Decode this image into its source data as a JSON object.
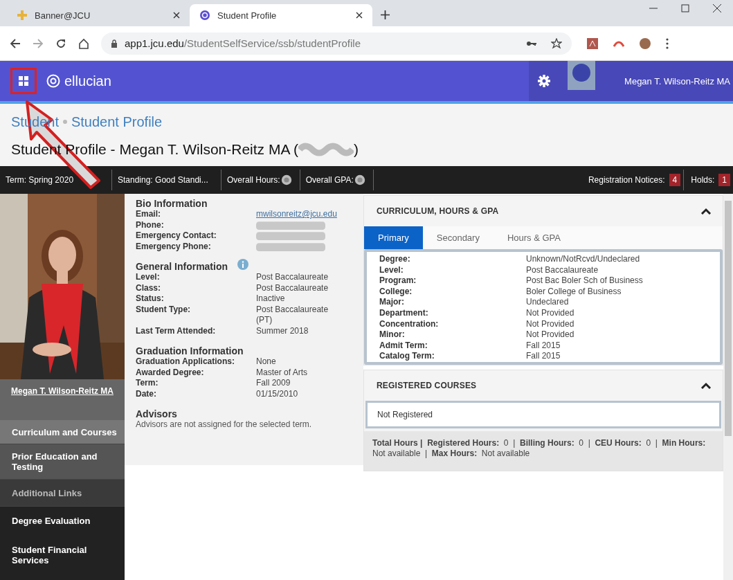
{
  "browser": {
    "tabs": [
      {
        "title": "Banner@JCU",
        "selected": false
      },
      {
        "title": "Student Profile",
        "selected": true
      }
    ],
    "url_host": "app1.jcu.edu",
    "url_path": "/StudentSelfService/ssb/studentProfile"
  },
  "header": {
    "brand": "ellucian",
    "user_name": "Megan T. Wilson-Reitz MA"
  },
  "breadcrumb": [
    "Student",
    "Student Profile"
  ],
  "page_title": {
    "text": "Student Profile - Megan T. Wilson-Reitz MA (",
    "close": ")"
  },
  "summary_bar": {
    "items": [
      {
        "label": "Term:",
        "value": "Spring 2020",
        "kind": "text"
      },
      {
        "label": "Standing:",
        "value": "Good Standi...",
        "kind": "text"
      },
      {
        "label": "Overall Hours:",
        "kind": "redacted"
      },
      {
        "label": "Overall GPA:",
        "kind": "redacted"
      }
    ],
    "badges": [
      {
        "label": "Registration Notices:",
        "count": "4"
      },
      {
        "label": "Holds:",
        "count": "1"
      }
    ]
  },
  "sidebar": {
    "profile_name": "Megan T. Wilson-Reitz MA",
    "items": [
      {
        "label": "Curriculum and Courses",
        "kind": "section",
        "selected": true
      },
      {
        "label": "Prior Education and Testing",
        "kind": "section",
        "selected": false
      },
      {
        "label": "Additional Links",
        "kind": "heading",
        "selected": false
      },
      {
        "label": "Degree Evaluation",
        "kind": "link",
        "selected": false
      },
      {
        "label": "Student Financial Services",
        "kind": "link",
        "selected": false
      }
    ]
  },
  "profile_sections": [
    {
      "title": "Bio Information",
      "info": false,
      "rows": [
        {
          "label": "Email:",
          "value": "mwilsonreitz@jcu.edu",
          "kind": "link"
        },
        {
          "label": "Phone:",
          "kind": "redacted"
        },
        {
          "label": "Emergency Contact:",
          "kind": "redacted"
        },
        {
          "label": "Emergency Phone:",
          "kind": "redacted"
        }
      ]
    },
    {
      "title": "General Information",
      "info": true,
      "rows": [
        {
          "label": "Level:",
          "value": "Post Baccalaureate",
          "kind": "text"
        },
        {
          "label": "Class:",
          "value": "Post Baccalaureate",
          "kind": "text"
        },
        {
          "label": "Status:",
          "value": "Inactive",
          "kind": "text"
        },
        {
          "label": "Student Type:",
          "value": "Post Baccalaureate (PT)",
          "kind": "text"
        },
        {
          "label": "Last Term Attended:",
          "value": "Summer 2018",
          "kind": "text"
        }
      ]
    },
    {
      "title": "Graduation Information",
      "info": false,
      "rows": [
        {
          "label": "Graduation Applications:",
          "value": "None",
          "kind": "text"
        },
        {
          "label": "Awarded Degree:",
          "value": "Master of Arts",
          "kind": "text"
        },
        {
          "label": "Term:",
          "value": "Fall 2009",
          "kind": "text"
        },
        {
          "label": "Date:",
          "value": "01/15/2010",
          "kind": "text"
        }
      ]
    },
    {
      "title": "Advisors",
      "info": false,
      "note": "Advisors are not assigned for the selected term."
    }
  ],
  "curriculum_panel": {
    "title": "CURRICULUM, HOURS & GPA",
    "expanded": true,
    "tabs": [
      {
        "label": "Primary",
        "selected": true
      },
      {
        "label": "Secondary",
        "selected": false
      },
      {
        "label": "Hours & GPA",
        "selected": false
      }
    ],
    "rows": [
      {
        "label": "Degree:",
        "value": "Unknown/NotRcvd/Undeclared"
      },
      {
        "label": "Level:",
        "value": "Post Baccalaureate"
      },
      {
        "label": "Program:",
        "value": "Post Bac Boler Sch of Business"
      },
      {
        "label": "College:",
        "value": "Boler College of Business"
      },
      {
        "label": "Major:",
        "value": "Undeclared"
      },
      {
        "label": "Department:",
        "value": "Not Provided"
      },
      {
        "label": "Concentration:",
        "value": "Not Provided"
      },
      {
        "label": "Minor:",
        "value": "Not Provided"
      },
      {
        "label": "Admit Term:",
        "value": "Fall 2015"
      },
      {
        "label": "Catalog Term:",
        "value": "Fall 2015"
      }
    ]
  },
  "courses_panel": {
    "title": "REGISTERED COURSES",
    "expanded": true,
    "message": "Not Registered",
    "totals": "**Total Hours |**  **Registered Hours:**  0  |  **Billing Hours:**  0  |  **CEU Hours:**  0  |  **Min Hours:**  Not available  |  **Max Hours:**  Not available"
  }
}
